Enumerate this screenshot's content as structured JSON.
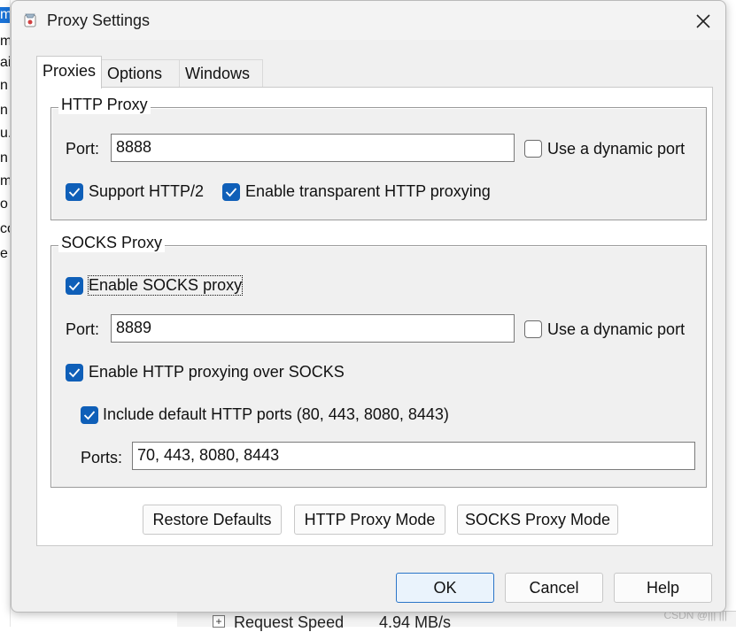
{
  "dialog": {
    "title": "Proxy Settings",
    "app_icon": "fiddler-app-icon",
    "close_icon": "close-icon"
  },
  "tabs": [
    {
      "label": "Proxies",
      "active": true
    },
    {
      "label": "Options",
      "active": false
    },
    {
      "label": "Windows",
      "active": false
    }
  ],
  "http_proxy": {
    "title": "HTTP Proxy",
    "port_label": "Port:",
    "port_value": "8888",
    "dynamic_port_label": "Use a dynamic port",
    "dynamic_port_checked": false,
    "support_http2_label": "Support HTTP/2",
    "support_http2_checked": true,
    "transparent_label": "Enable transparent HTTP proxying",
    "transparent_checked": true
  },
  "socks_proxy": {
    "title": "SOCKS Proxy",
    "enable_label": "Enable SOCKS proxy",
    "enable_checked": true,
    "port_label": "Port:",
    "port_value": "8889",
    "dynamic_port_label": "Use a dynamic port",
    "dynamic_port_checked": false,
    "http_over_socks_label": "Enable HTTP proxying over SOCKS",
    "http_over_socks_checked": true,
    "include_default_ports_label": "Include default HTTP ports (80, 443, 8080, 8443)",
    "include_default_ports_checked": true,
    "ports_label": "Ports:",
    "ports_value": "70, 443, 8080, 8443"
  },
  "mode_buttons": {
    "restore": "Restore Defaults",
    "http_mode": "HTTP Proxy Mode",
    "socks_mode": "SOCKS Proxy Mode"
  },
  "footer_buttons": {
    "ok": "OK",
    "cancel": "Cancel",
    "help": "Help"
  },
  "background": {
    "list_rows": [
      "m",
      "m",
      "ai",
      "n",
      "n",
      "u.",
      "n",
      "m",
      "o",
      "co",
      "e"
    ],
    "status_label": "Request Speed",
    "status_value": "4.94 MB/s",
    "expander": "+"
  },
  "watermark": "CSDN @||| |||",
  "colors": {
    "checkbox_accent": "#0f5fb8",
    "default_button_border": "#2b75c8",
    "dialog_bg": "#f0f0f0"
  }
}
